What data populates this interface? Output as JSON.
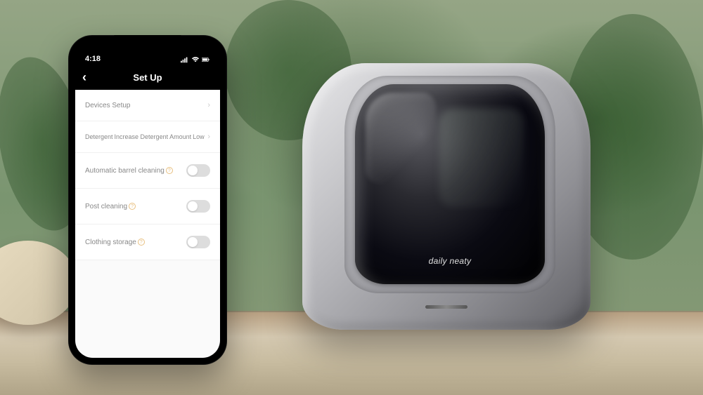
{
  "device": {
    "brand_text": "daily neaty"
  },
  "phone": {
    "status": {
      "time": "4:18",
      "signal": "signal-icon",
      "wifi": "wifi-icon",
      "battery": "battery-icon"
    },
    "nav": {
      "title": "Set Up",
      "back_label": "‹"
    },
    "settings": [
      {
        "id": "devices-setup",
        "label": "Devices Setup",
        "type": "nav",
        "value": ""
      },
      {
        "id": "detergent",
        "label": "Detergent",
        "sublabel": "Increase Detergent Amount",
        "type": "nav",
        "value": "Low"
      },
      {
        "id": "auto-barrel-cleaning",
        "label": "Automatic barrel cleaning",
        "type": "toggle",
        "on": false,
        "has_info": true
      },
      {
        "id": "post-cleaning",
        "label": "Post cleaning",
        "type": "toggle",
        "on": false,
        "has_info": true
      },
      {
        "id": "clothing-storage",
        "label": "Clothing storage",
        "type": "toggle",
        "on": false,
        "has_info": true
      }
    ]
  }
}
